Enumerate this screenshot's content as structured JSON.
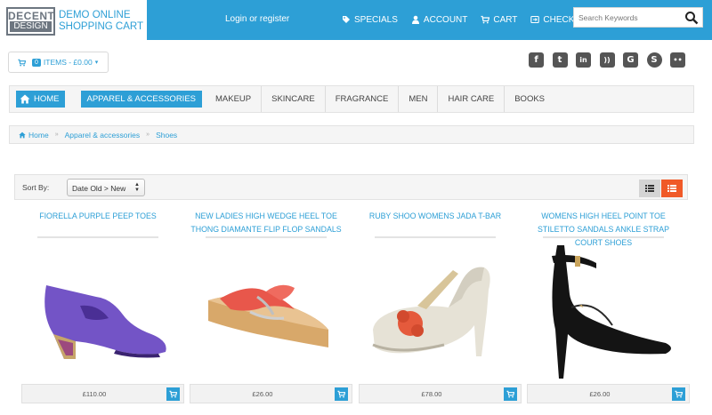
{
  "brand": {
    "badge_top": "DECENT",
    "badge_bottom": "DESIGN",
    "tagline_line1": "DEMO ONLINE",
    "tagline_line2": "SHOPPING CART",
    "color": "#2d9fd6"
  },
  "header": {
    "login_label": "Login or register",
    "nav": [
      {
        "label": "SPECIALS",
        "icon": "tag-icon"
      },
      {
        "label": "ACCOUNT",
        "icon": "user-icon"
      },
      {
        "label": "CART",
        "icon": "cart-icon"
      },
      {
        "label": "CHECKOUT",
        "icon": "checkout-icon"
      }
    ],
    "search_placeholder": "Search Keywords"
  },
  "cart_dropdown": {
    "count": "0",
    "label": "ITEMS - £0.00",
    "caret": "▾"
  },
  "social": [
    {
      "name": "facebook-icon",
      "glyph": "f"
    },
    {
      "name": "twitter-icon",
      "glyph": "t"
    },
    {
      "name": "linkedin-icon",
      "glyph": "in"
    },
    {
      "name": "rss-icon",
      "glyph": "))"
    },
    {
      "name": "google-icon",
      "glyph": "G"
    },
    {
      "name": "skype-icon",
      "glyph": "S"
    },
    {
      "name": "flickr-icon",
      "glyph": "••"
    }
  ],
  "main_nav": {
    "home": "HOME",
    "active": "APPAREL & ACCESSORIES",
    "items": [
      "MAKEUP",
      "SKINCARE",
      "FRAGRANCE",
      "MEN",
      "HAIR CARE",
      "BOOKS"
    ]
  },
  "breadcrumb": {
    "home": "Home",
    "level1": "Apparel & accessories",
    "level2": "Shoes",
    "sep": "»"
  },
  "sort": {
    "label": "Sort By:",
    "selected": "Date Old > New",
    "active_view": "grid"
  },
  "products": [
    {
      "title": "FIORELLA PURPLE PEEP TOES",
      "price": "£110.00",
      "image": "purple-wedge-shoe"
    },
    {
      "title": "NEW LADIES HIGH WEDGE HEEL TOE THONG DIAMANTE FLIP FLOP SANDALS",
      "price": "£26.00",
      "image": "wedge-flip-flop-sandal"
    },
    {
      "title": "RUBY SHOO WOMENS JADA T-BAR",
      "price": "£78.00",
      "image": "t-bar-shoe"
    },
    {
      "title": "WOMENS HIGH HEEL POINT TOE STILETTO SANDALS ANKLE STRAP COURT SHOES",
      "price": "£26.00",
      "image": "black-stiletto"
    }
  ]
}
